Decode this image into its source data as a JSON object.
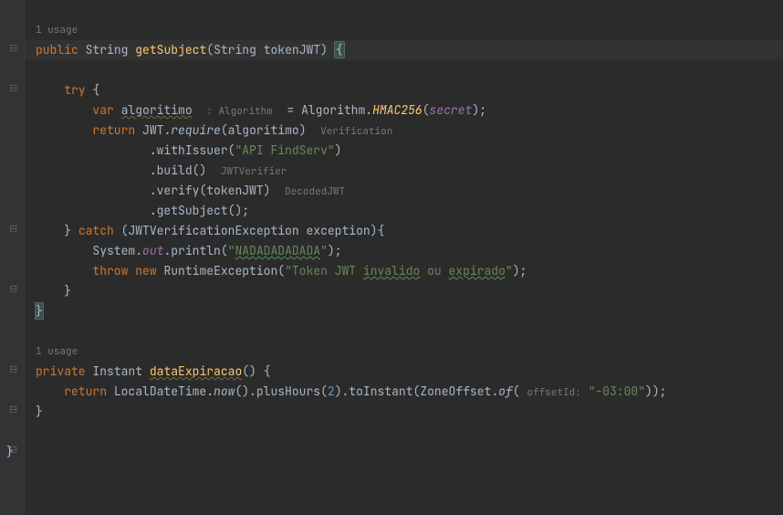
{
  "usage1": "1 usage",
  "usage2": "1 usage",
  "line_public": {
    "kw_public": "public",
    "type_string": "String",
    "method": "getSubject",
    "param_type": "String",
    "param_name": "tokenJWT"
  },
  "try_kw": "try",
  "var_line": {
    "kw_var": "var",
    "name": "algoritimo",
    "hint": ": Algorithm",
    "class": "Algorithm",
    "method": "HMAC256",
    "arg": "secret"
  },
  "return_jwt": {
    "kw_return": "return",
    "class": "JWT",
    "method": "require",
    "arg": "algoritimo",
    "hint": "Verification"
  },
  "withIssuer": {
    "method": "withIssuer",
    "str": "\"API FindServ\""
  },
  "build": {
    "method": "build",
    "hint": "JWTVerifier"
  },
  "verify": {
    "method": "verify",
    "arg": "tokenJWT",
    "hint": "DecodedJWT"
  },
  "getSubject": {
    "method": "getSubject"
  },
  "catch_line": {
    "kw_catch": "catch",
    "ex_type": "JWTVerificationException",
    "ex_name": "exception"
  },
  "println_line": {
    "class": "System",
    "field": "out",
    "method": "println",
    "str": "NADADADADADA"
  },
  "throw_line": {
    "kw_throw": "throw",
    "kw_new": "new",
    "ex": "RuntimeException",
    "s1": "\"Token JWT ",
    "s2": "invalido",
    "s3": " ou ",
    "s4": "expirado",
    "s5": "\""
  },
  "private_method": {
    "kw_private": "private",
    "type": "Instant",
    "name": "dataExpiracao"
  },
  "return_local": {
    "kw_return": "return",
    "class": "LocalDateTime",
    "now": "now",
    "plusHours": "plusHours",
    "hours": "2",
    "toInstant": "toInstant",
    "zone": "ZoneOffset",
    "of": "of",
    "hint": "offsetId:",
    "str": "\"-03:00\""
  }
}
